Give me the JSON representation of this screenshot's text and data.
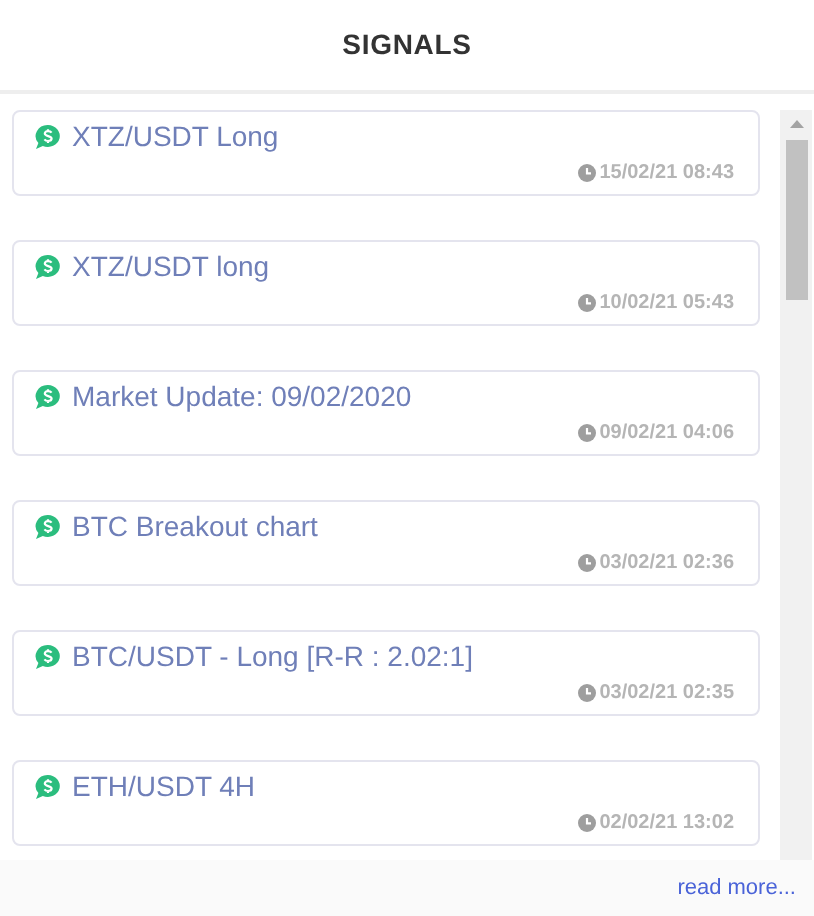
{
  "header": {
    "title": "SIGNALS"
  },
  "signals": [
    {
      "title": "XTZ/USDT Long",
      "time": "15/02/21 08:43"
    },
    {
      "title": "XTZ/USDT long",
      "time": "10/02/21 05:43"
    },
    {
      "title": "Market Update: 09/02/2020",
      "time": "09/02/21 04:06"
    },
    {
      "title": "BTC Breakout chart",
      "time": "03/02/21 02:36"
    },
    {
      "title": "BTC/USDT - Long [R-R : 2.02:1]",
      "time": "03/02/21 02:35"
    },
    {
      "title": "ETH/USDT 4H",
      "time": "02/02/21 13:02"
    }
  ],
  "footer": {
    "link": "read more..."
  }
}
